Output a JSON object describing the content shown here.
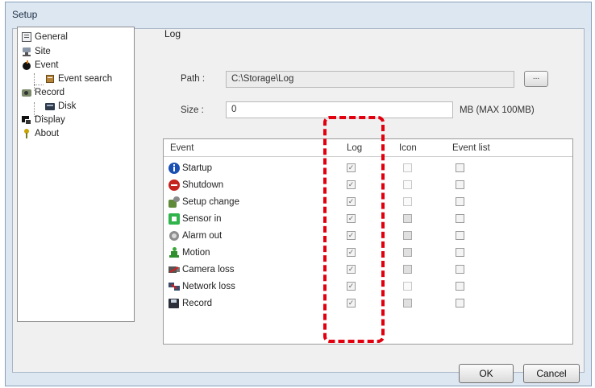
{
  "window": {
    "title": "Setup"
  },
  "tree": {
    "items": [
      {
        "label": "General",
        "icon": "general-icon"
      },
      {
        "label": "Site",
        "icon": "site-icon"
      },
      {
        "label": "Event",
        "icon": "event-icon"
      },
      {
        "label": "Event search",
        "icon": "event-search-icon"
      },
      {
        "label": "Record",
        "icon": "record-icon"
      },
      {
        "label": "Disk",
        "icon": "disk-icon"
      },
      {
        "label": "Display",
        "icon": "display-icon"
      },
      {
        "label": "About",
        "icon": "about-icon"
      }
    ]
  },
  "log": {
    "group_label": "Log",
    "path_label": "Path :",
    "path_value": "C:\\Storage\\Log",
    "browse_label": "...",
    "size_label": "Size :",
    "size_value": "0",
    "size_unit": "MB  (MAX 100MB)"
  },
  "events": {
    "columns": [
      "Event",
      "Log",
      "Icon",
      "Event list"
    ],
    "rows": [
      {
        "name": "Startup",
        "icon": "info-icon",
        "log": true,
        "icon_state": "disabled",
        "list_state": "enabled"
      },
      {
        "name": "Shutdown",
        "icon": "shutdown-icon",
        "log": true,
        "icon_state": "disabled",
        "list_state": "enabled"
      },
      {
        "name": "Setup change",
        "icon": "setup-change-icon",
        "log": true,
        "icon_state": "disabled",
        "list_state": "enabled"
      },
      {
        "name": "Sensor in",
        "icon": "sensor-icon",
        "log": true,
        "icon_state": "enabled",
        "list_state": "enabled"
      },
      {
        "name": "Alarm out",
        "icon": "alarm-icon",
        "log": true,
        "icon_state": "enabled",
        "list_state": "enabled"
      },
      {
        "name": "Motion",
        "icon": "motion-icon",
        "log": true,
        "icon_state": "enabled",
        "list_state": "enabled"
      },
      {
        "name": "Camera loss",
        "icon": "camera-loss-icon",
        "log": true,
        "icon_state": "enabled",
        "list_state": "enabled"
      },
      {
        "name": "Network loss",
        "icon": "network-loss-icon",
        "log": true,
        "icon_state": "disabled",
        "list_state": "enabled"
      },
      {
        "name": "Record",
        "icon": "record-disk-icon",
        "log": true,
        "icon_state": "enabled",
        "list_state": "enabled"
      }
    ]
  },
  "buttons": {
    "ok": "OK",
    "cancel": "Cancel"
  },
  "colors": {
    "highlight": "#e2000f",
    "window_bg": "#dde7f2"
  }
}
